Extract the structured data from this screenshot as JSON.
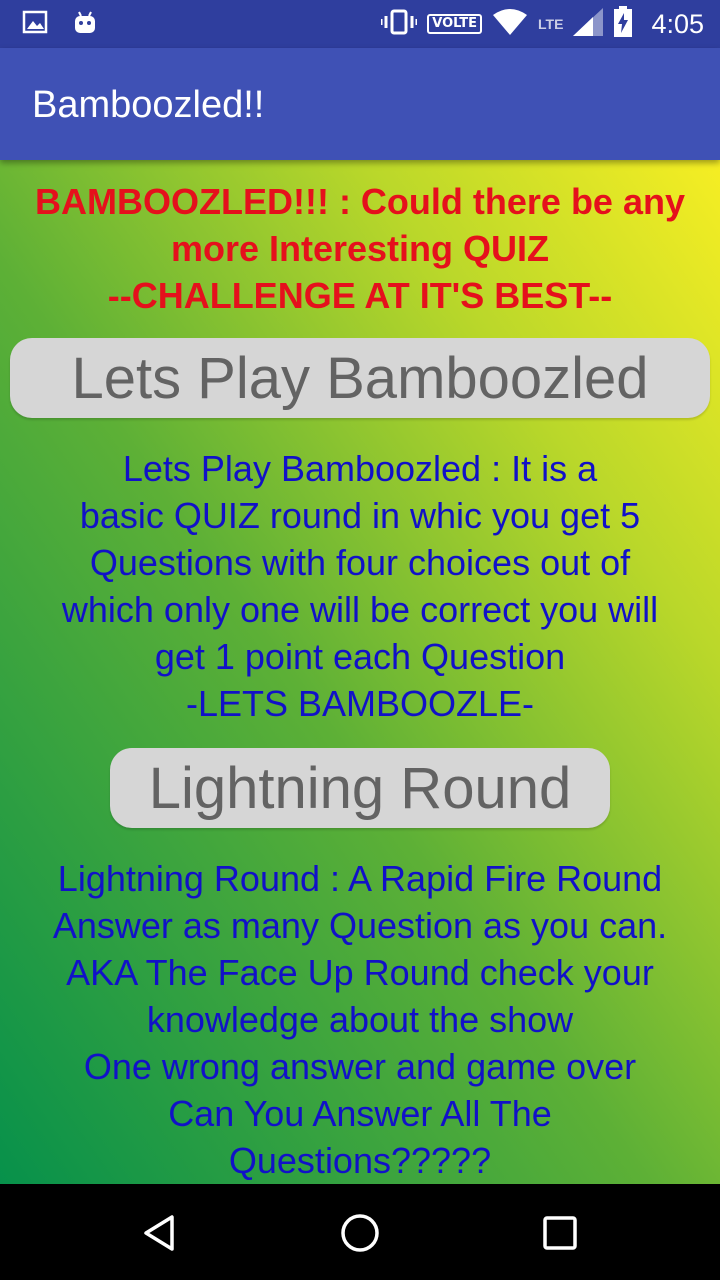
{
  "status_bar": {
    "time": "4:05",
    "volte_label": "VOLTE",
    "lte_label": "LTE",
    "icons": [
      "image-icon",
      "android-icon",
      "vibrate-icon",
      "wifi-icon",
      "signal-icon",
      "battery-charging-icon"
    ]
  },
  "app_bar": {
    "title": "Bamboozled!!",
    "color": "#3f51b5"
  },
  "content": {
    "header": "BAMBOOZLED!!! : Could there be any\nmore Interesting QUIZ\n--CHALLENGE AT IT'S BEST--",
    "play_button_label": "Lets Play Bamboozled",
    "play_description": "Lets Play Bamboozled : It is a\nbasic QUIZ round in whic you get 5\nQuestions with four choices out of\nwhich only one will be correct you will\nget 1 point each Question\n-LETS BAMBOOZLE-",
    "lightning_button_label": "Lightning Round",
    "lightning_description": "Lightning Round : A Rapid Fire Round\nAnswer as many Question as you can.\n AKA The Face Up Round check your\nknowledge about the show\nOne wrong answer and game over\nCan You Answer All The\nQuestions?????"
  },
  "colors": {
    "header_text": "#e5101c",
    "description_text": "#1111c8",
    "button_bg": "#d6d6d6",
    "button_text": "#636363"
  },
  "nav_bar": {
    "icons": [
      "back-icon",
      "home-icon",
      "recents-icon"
    ]
  }
}
